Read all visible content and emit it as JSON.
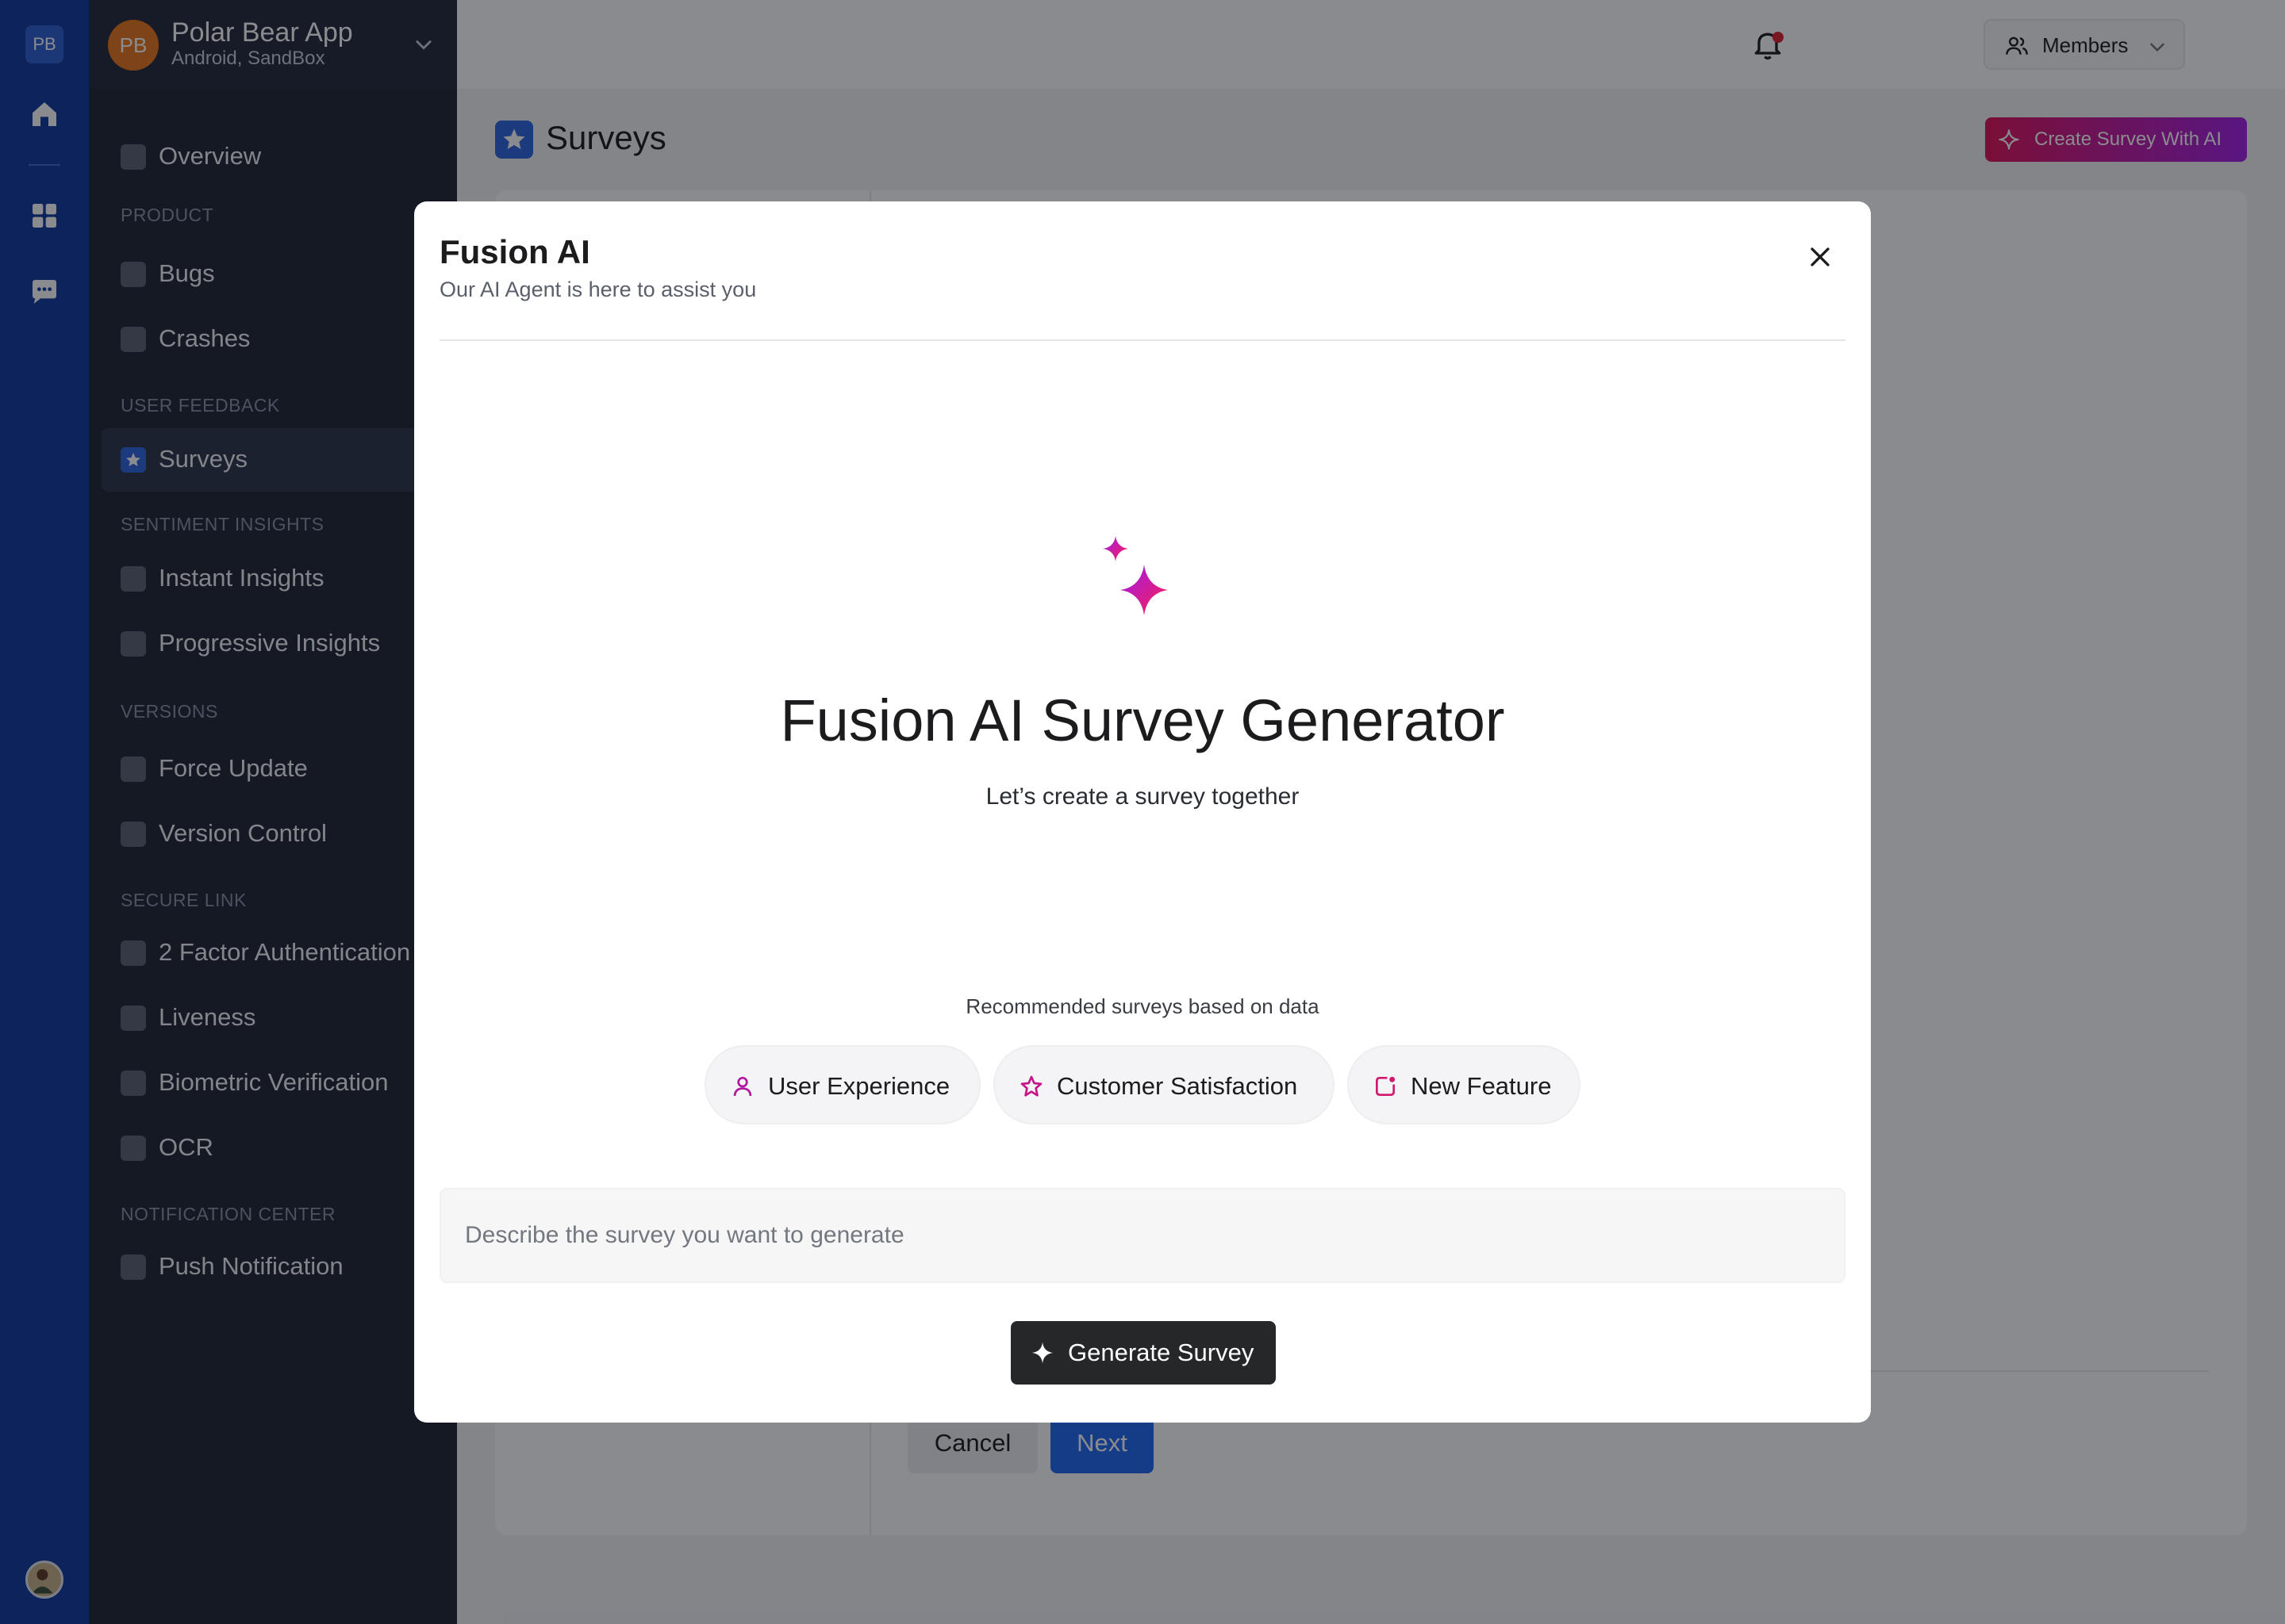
{
  "rail": {
    "workspace_initials": "PB",
    "icons": [
      "home-icon",
      "grid-icon",
      "chat-icon"
    ]
  },
  "sidebar": {
    "logo_initials": "PB",
    "app_name": "Polar Bear App",
    "platform": "Android, SandBox",
    "sections": {
      "product": "PRODUCT",
      "user_feedback": "USER FEEDBACK",
      "sentiment": "SENTIMENT INSIGHTS",
      "versions": "VERSIONS",
      "secure_link": "SECURE LINK",
      "notification": "NOTIFICATION CENTER"
    },
    "items": [
      {
        "label": "Overview",
        "icon": "home-icon"
      },
      {
        "label": "Bugs",
        "icon": "bug-icon"
      },
      {
        "label": "Crashes",
        "icon": "crash-icon"
      },
      {
        "label": "Surveys",
        "icon": "star-icon",
        "active": true
      },
      {
        "label": "Instant Insights",
        "icon": "heart-icon"
      },
      {
        "label": "Progressive Insights",
        "icon": "link-icon"
      },
      {
        "label": "Force Update",
        "icon": "upload-icon"
      },
      {
        "label": "Version Control",
        "icon": "box-icon"
      },
      {
        "label": "2 Factor Authentication",
        "icon": "lock-icon"
      },
      {
        "label": "Liveness",
        "icon": "face-scan-icon"
      },
      {
        "label": "Biometric Verification",
        "icon": "fingerprint-icon"
      },
      {
        "label": "OCR",
        "icon": "scan-icon"
      },
      {
        "label": "Push Notification",
        "icon": "bell-icon"
      }
    ]
  },
  "topbar": {
    "members_label": "Members"
  },
  "page": {
    "title": "Surveys",
    "create_ai_label": "Create Survey With AI",
    "cancel_label": "Cancel",
    "next_label": "Next"
  },
  "modal": {
    "title": "Fusion AI",
    "subtitle": "Our AI Agent is here to assist you",
    "heading": "Fusion AI Survey Generator",
    "tagline": "Let’s create a survey together",
    "recommended_label": "Recommended surveys based on data",
    "chips": [
      {
        "label": "User Experience",
        "icon": "user-icon"
      },
      {
        "label": "Customer Satisfaction",
        "icon": "star-outline-icon"
      },
      {
        "label": "New Feature",
        "icon": "new-feature-icon"
      }
    ],
    "input_placeholder": "Describe the survey you want to generate",
    "input_value": "",
    "generate_label": "Generate Survey"
  },
  "colors": {
    "rail": "#0f3b9e",
    "sidebar": "#1d2535",
    "ai_gradient_start": "#e0135a",
    "ai_gradient_end": "#a21fe6",
    "primary": "#1f68f2"
  }
}
